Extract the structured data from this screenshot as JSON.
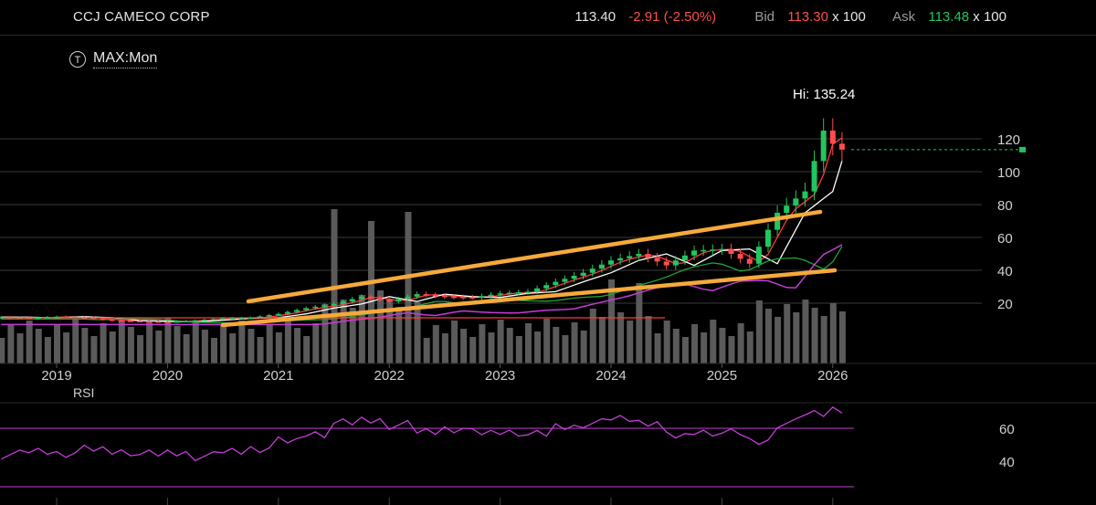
{
  "header": {
    "ticker": "CCJ CAMECO CORP",
    "last": "113.40",
    "change": "-2.91 (-2.50%)",
    "bid_label": "Bid",
    "bid": "113.30",
    "bid_size": "x 100",
    "ask_label": "Ask",
    "ask": "113.48",
    "ask_size": "x 100"
  },
  "toolbar": {
    "timeframe_icon": "T",
    "timeframe": "MAX:Mon"
  },
  "colors": {
    "up": "#22c55e",
    "down": "#ff4d4d",
    "ma_fast": "#ff3b3b",
    "ma_mid": "#ffffff",
    "ma_slow": "#1fa53a",
    "lower_band": "#c33dd6",
    "rsi": "#c33dd6",
    "trendline": "#f7a93b",
    "volume": "#5a5a5a",
    "grid": "#3a3a3a"
  },
  "chart_data": [
    {
      "type": "candlestick",
      "title": "CCJ CAMECO CORP",
      "interval": "Monthly",
      "x_tick_labels": [
        "2019",
        "2020",
        "2021",
        "2022",
        "2023",
        "2024",
        "2025",
        "2026"
      ],
      "y_tick_labels": [
        "20",
        "40",
        "60",
        "80",
        "100",
        "120"
      ],
      "ylim": [
        0,
        140
      ],
      "high_annotation": "Hi: 135.24",
      "high_value": 135.24,
      "last_price": 113.4,
      "grid": true,
      "closes": [
        {
          "date": "2018-07",
          "close": 11.5
        },
        {
          "date": "2018-10",
          "close": 11.0
        },
        {
          "date": "2019-01",
          "close": 11.8
        },
        {
          "date": "2019-04",
          "close": 11.2
        },
        {
          "date": "2019-07",
          "close": 9.5
        },
        {
          "date": "2019-10",
          "close": 9.0
        },
        {
          "date": "2020-01",
          "close": 8.6
        },
        {
          "date": "2020-04",
          "close": 9.6
        },
        {
          "date": "2020-07",
          "close": 10.8
        },
        {
          "date": "2020-10",
          "close": 11.2
        },
        {
          "date": "2021-01",
          "close": 13.5
        },
        {
          "date": "2021-04",
          "close": 17.0
        },
        {
          "date": "2021-07",
          "close": 19.5
        },
        {
          "date": "2021-10",
          "close": 24.0
        },
        {
          "date": "2022-01",
          "close": 21.0
        },
        {
          "date": "2022-04",
          "close": 25.5
        },
        {
          "date": "2022-07",
          "close": 24.0
        },
        {
          "date": "2022-10",
          "close": 23.5
        },
        {
          "date": "2023-01",
          "close": 26.0
        },
        {
          "date": "2023-04",
          "close": 27.0
        },
        {
          "date": "2023-07",
          "close": 33.0
        },
        {
          "date": "2023-10",
          "close": 38.5
        },
        {
          "date": "2024-01",
          "close": 46.0
        },
        {
          "date": "2024-04",
          "close": 50.0
        },
        {
          "date": "2024-07",
          "close": 43.0
        },
        {
          "date": "2024-10",
          "close": 52.0
        },
        {
          "date": "2025-01",
          "close": 53.0
        },
        {
          "date": "2025-04",
          "close": 44.0
        },
        {
          "date": "2025-07",
          "close": 75.0
        },
        {
          "date": "2025-10",
          "close": 88.0
        },
        {
          "date": "2025-12",
          "close": 125.0
        },
        {
          "date": "2026-01",
          "close": 117.0
        },
        {
          "date": "2026-02",
          "close": 113.4
        }
      ]
    },
    {
      "type": "line",
      "title": "RSI",
      "y_tick_labels": [
        "40",
        "60"
      ],
      "ylim": [
        30,
        80
      ],
      "series": [
        {
          "values": [
            44,
            46,
            45,
            47,
            46,
            44,
            45,
            43,
            46,
            48,
            52,
            57,
            63,
            65,
            62,
            58,
            60,
            57,
            58,
            56,
            61,
            63,
            66,
            64,
            55,
            58,
            57,
            52,
            63,
            69,
            72,
            67,
            68
          ]
        }
      ]
    }
  ]
}
